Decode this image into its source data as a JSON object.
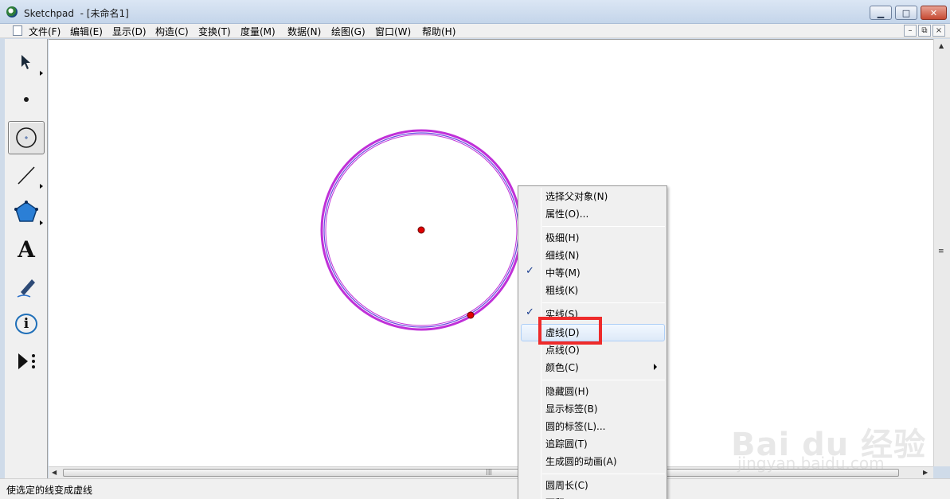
{
  "window": {
    "title": "Sketchpad  - [未命名1]",
    "min_glyph": "▁",
    "max_glyph": "□",
    "close_glyph": "✕"
  },
  "menubar": {
    "items": [
      "文件(F)",
      "编辑(E)",
      "显示(D)",
      "构造(C)",
      "变换(T)",
      "度量(M)",
      "数据(N)",
      "绘图(G)",
      "窗口(W)",
      "帮助(H)"
    ],
    "mdi": [
      "–",
      "⧉",
      "×"
    ]
  },
  "toolbox": {
    "tools": [
      "selection-arrow-icon",
      "point-tool-icon",
      "compass-tool-icon",
      "straightedge-tool-icon",
      "polygon-tool-icon",
      "text-tool-icon",
      "marker-tool-icon",
      "information-tool-icon",
      "custom-tool-icon"
    ],
    "active": "compass-tool-icon",
    "text_tool_glyph": "A",
    "info_glyph": "i"
  },
  "scroll": {
    "thumb_grip": "|||",
    "left": "◀",
    "right": "▶"
  },
  "status": {
    "text": "使选定的线变成虚线"
  },
  "context_menu": {
    "items": [
      {
        "label": "选择父对象(N)",
        "checked": false
      },
      {
        "label": "属性(O)...",
        "checked": false
      },
      {
        "label": "极细(H)",
        "checked": false
      },
      {
        "label": "细线(N)",
        "checked": false
      },
      {
        "label": "中等(M)",
        "checked": true
      },
      {
        "label": "粗线(K)",
        "checked": false
      },
      {
        "label": "实线(S)",
        "checked": true
      },
      {
        "label": "虚线(D)",
        "checked": false,
        "hovered": true
      },
      {
        "label": "点线(O)",
        "checked": false
      },
      {
        "label": "颜色(C)",
        "checked": false,
        "submenu": true
      },
      {
        "label": "隐藏圆(H)",
        "checked": false
      },
      {
        "label": "显示标签(B)",
        "checked": false
      },
      {
        "label": "圆的标签(L)...",
        "checked": false
      },
      {
        "label": "追踪圆(T)",
        "checked": false
      },
      {
        "label": "生成圆的动画(A)",
        "checked": false
      },
      {
        "label": "圆周长(C)",
        "checked": false
      },
      {
        "label": "面积",
        "checked": false
      }
    ],
    "check_glyph": "✓",
    "highlighted_item": "虚线(D)"
  },
  "colors": {
    "circle": "#c030d8",
    "circle_inner": "#6a48e0",
    "point": "#e00000",
    "highlight_box": "#ee2b2b"
  },
  "watermark": {
    "brand": "Bai du 经验",
    "url": "jingyan.baidu.com"
  }
}
